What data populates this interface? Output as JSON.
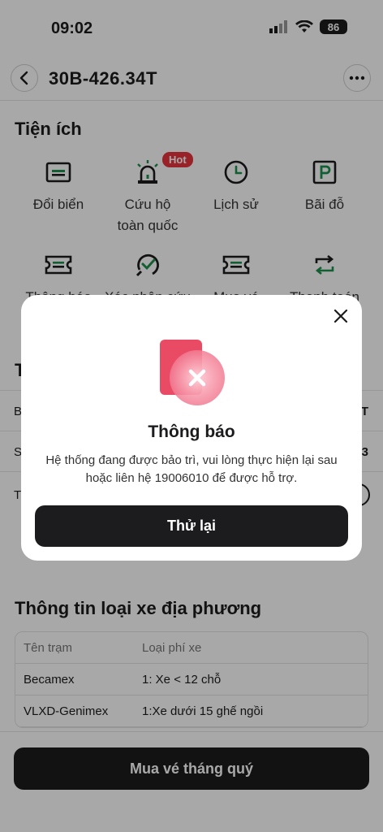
{
  "status_bar": {
    "time": "09:02",
    "battery": "86"
  },
  "header": {
    "plate": "30B-426.34T"
  },
  "utilities": {
    "title": "Tiện ích",
    "hot_badge": "Hot",
    "row1": [
      "Đổi biển",
      "Cứu hộ\ntoàn quốc",
      "Lịch sử",
      "Bãi đỗ"
    ],
    "row2_partial": [
      "Thông báo",
      "Xác nhận cứu",
      "Mua vé",
      "Thanh toán"
    ]
  },
  "info_section": {
    "title_initial": "T",
    "row_left": [
      "B",
      "S",
      "T"
    ],
    "row_right": [
      "T",
      "3",
      ""
    ]
  },
  "local_vehicle": {
    "title": "Thông tin loại xe địa phương",
    "columns": [
      "Tên trạm",
      "Loại phí xe"
    ],
    "rows": [
      [
        "Becamex",
        "1: Xe < 12 chỗ"
      ],
      [
        "VLXD-Genimex",
        "1:Xe dưới 15 ghế ngồi"
      ]
    ]
  },
  "bottom": {
    "buy_button": "Mua vé tháng quý"
  },
  "modal": {
    "title": "Thông báo",
    "message": "Hệ thống đang được bảo trì, vui lòng thực hiện lại sau hoặc liên hệ 19006010 để được hỗ trợ.",
    "retry_button": "Thử lại"
  },
  "colors": {
    "accent_dark": "#1c1c1e",
    "hot": "#e8343f",
    "icon_green": "#1f8f4e",
    "error_pink": "#e94b64"
  }
}
